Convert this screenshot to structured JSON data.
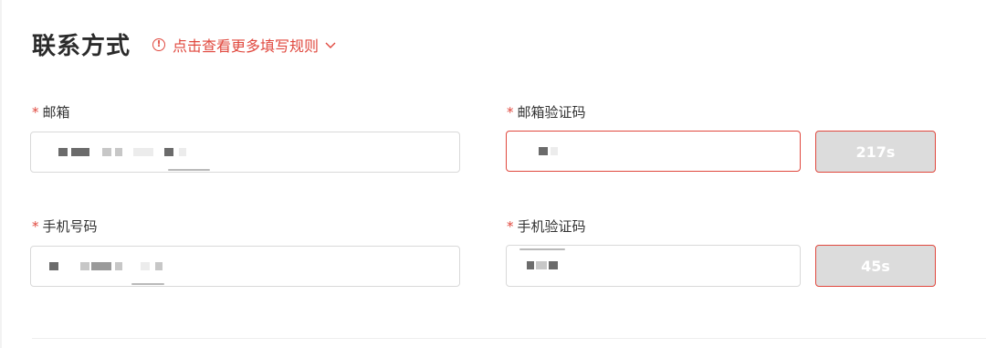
{
  "section": {
    "title": "联系方式",
    "rules_link": "点击查看更多填写规则"
  },
  "fields": {
    "email": {
      "required_mark": "*",
      "label": "邮箱"
    },
    "email_code": {
      "required_mark": "*",
      "label": "邮箱验证码",
      "countdown": "217s"
    },
    "phone": {
      "required_mark": "*",
      "label": "手机号码"
    },
    "phone_code": {
      "required_mark": "*",
      "label": "手机验证码",
      "countdown": "45s"
    }
  },
  "icons": {
    "rules_info": "info-circle-icon",
    "rules_expand": "chevron-down-icon"
  },
  "colors": {
    "accent": "#e0483e",
    "countdown_bg": "#dcdcdc"
  }
}
